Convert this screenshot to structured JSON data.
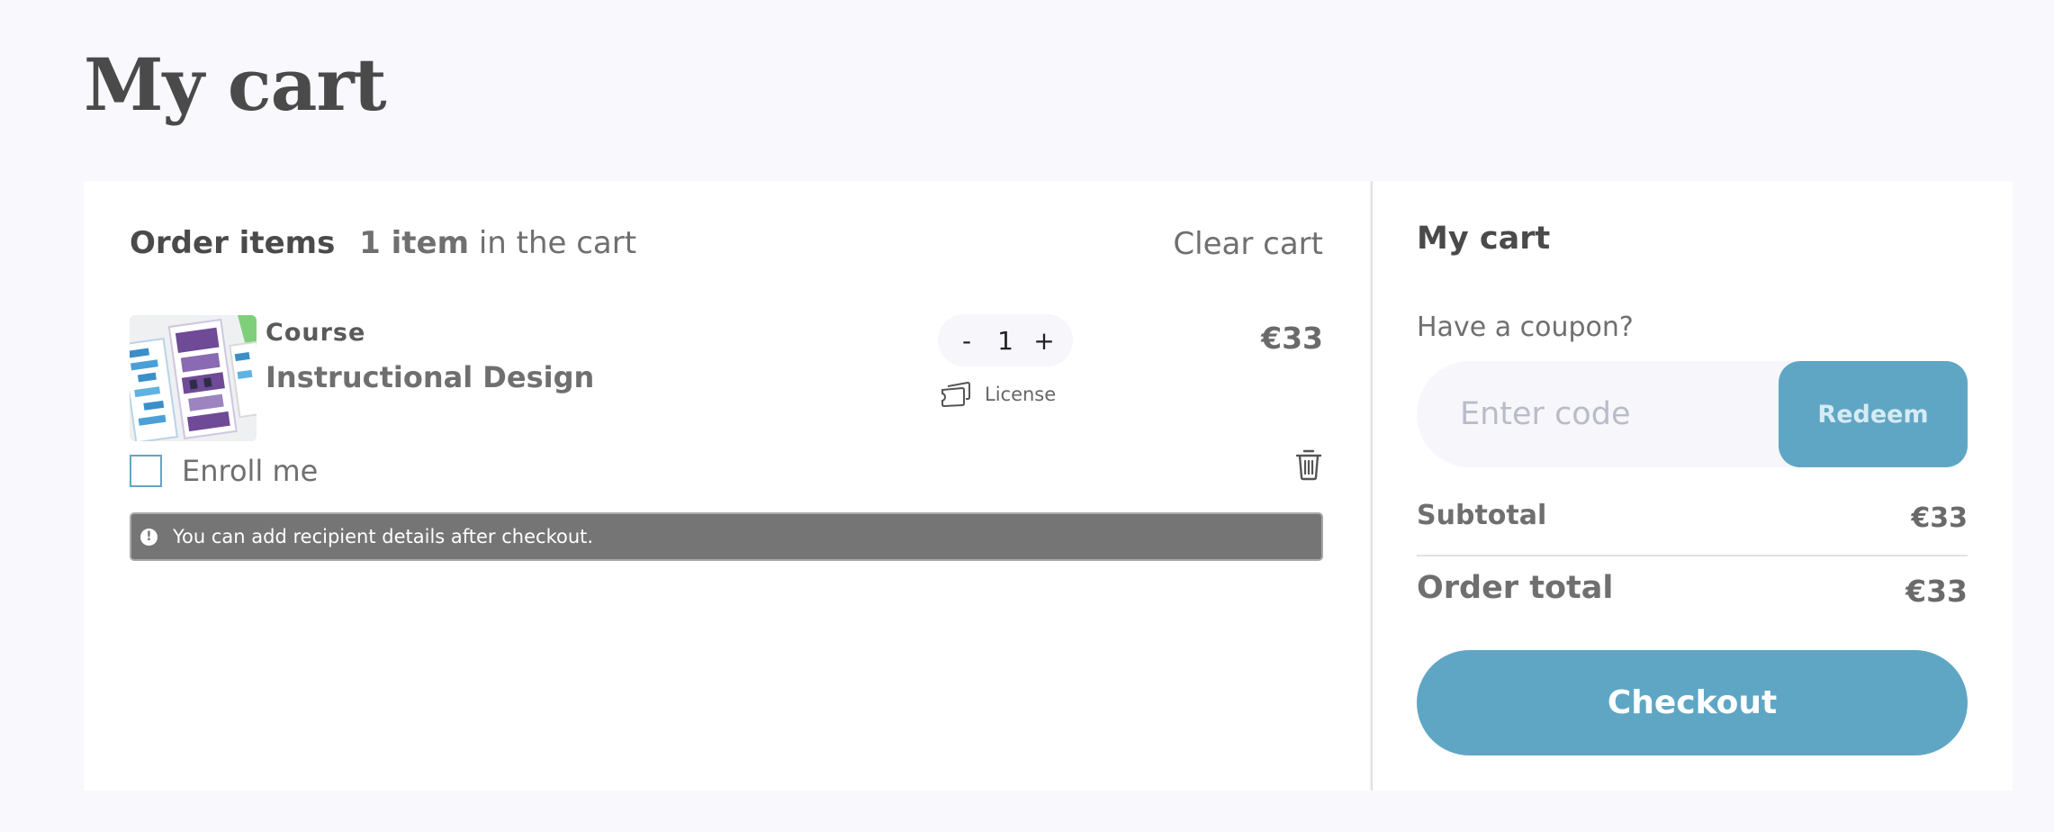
{
  "page": {
    "title": "My cart"
  },
  "cart": {
    "heading": "Order items",
    "item_count": "1 item",
    "item_count_suffix": "in the cart",
    "clear_label": "Clear cart",
    "items": [
      {
        "type": "Course",
        "name": "Instructional Design",
        "quantity": "1",
        "decrement_label": "-",
        "increment_label": "+",
        "license_label": "License",
        "price": "€33",
        "enroll_label": "Enroll me",
        "notice": "You can add recipient details after checkout.",
        "notice_icon": "!"
      }
    ]
  },
  "summary": {
    "title": "My cart",
    "coupon_label": "Have a coupon?",
    "coupon_placeholder": "Enter code",
    "redeem_label": "Redeem",
    "subtotal_label": "Subtotal",
    "subtotal_value": "€33",
    "total_label": "Order total",
    "total_value": "€33",
    "checkout_label": "Checkout"
  },
  "colors": {
    "accent": "#5fa6c4",
    "background": "#f8f8fd",
    "notice_bg": "#767576"
  },
  "icons": {
    "license": "license-ticket-icon",
    "delete": "trash-icon",
    "notice": "info-icon",
    "checkbox": "checkbox-unchecked"
  }
}
